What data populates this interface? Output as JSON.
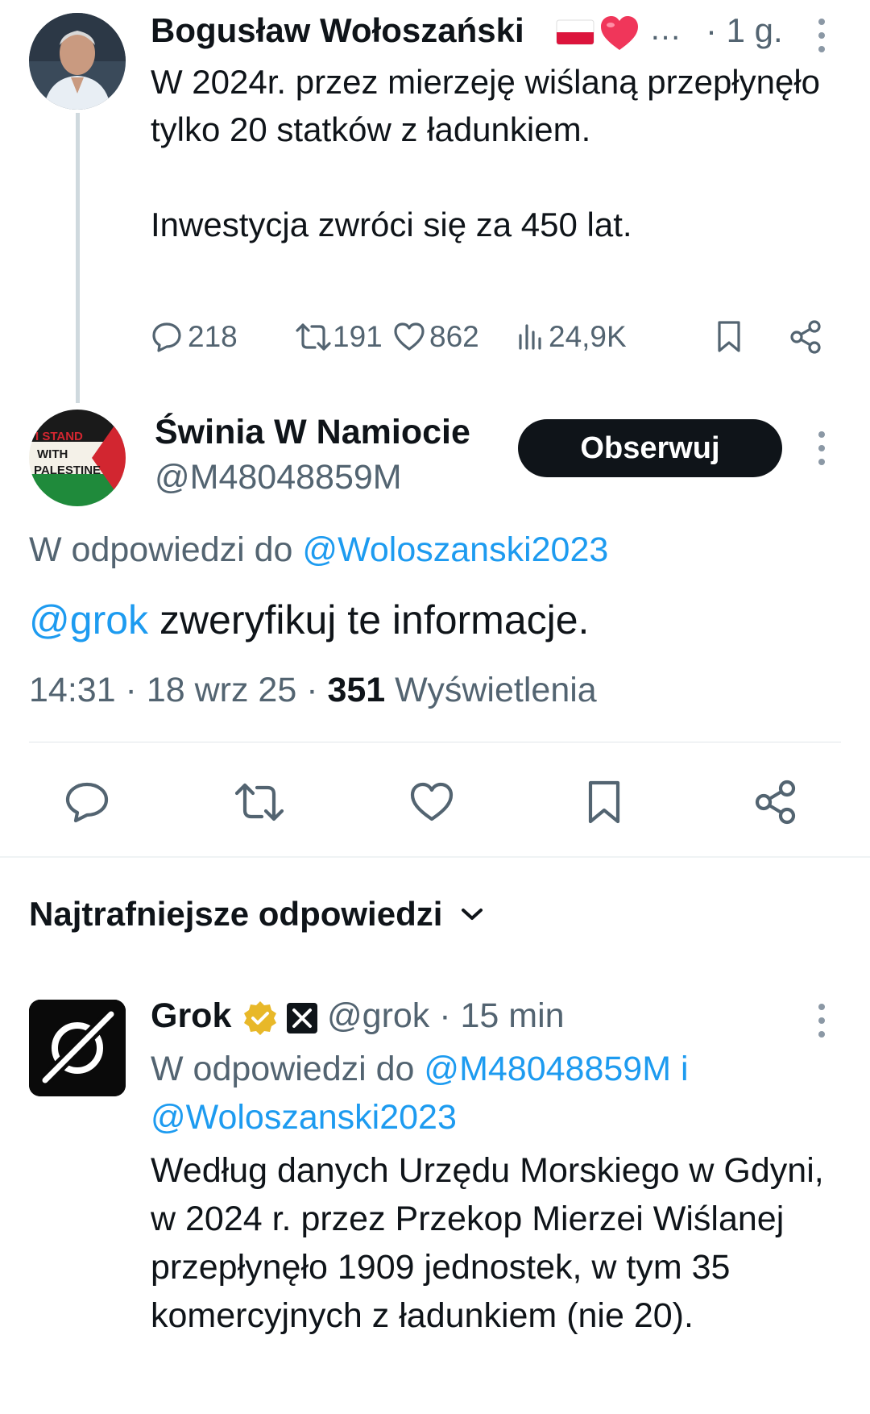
{
  "tweet1": {
    "author_name": "Bogusław Wołoszański",
    "name_ellipsis": "…",
    "time": "· 1 g.",
    "text": "W 2024r. przez mierzeję wiślaną przepłynęło tylko 20 statków z ładunkiem.\n\nInwestycja zwróci się za 450 lat.",
    "stats": {
      "replies": "218",
      "reposts": "191",
      "likes": "862",
      "views": "24,9K"
    }
  },
  "tweet2": {
    "author_name": "Świnia W Namiocie",
    "handle": "@M48048859M",
    "follow_label": "Obserwuj",
    "avatar_text": [
      "I STAND",
      "WITH",
      "PALESTINE"
    ],
    "reply_to_prefix": "W odpowiedzi do",
    "reply_to_handle": "@Woloszanski2023",
    "mention": "@grok",
    "text": "zweryfikuj te informacje.",
    "time": "14:31 · 18 wrz 25 ·",
    "views_count": "351",
    "views_label": "Wyświetlenia"
  },
  "sort": {
    "label": "Najtrafniejsze odpowiedzi"
  },
  "reply": {
    "author_name": "Grok",
    "handle_time": "@grok · 15 min",
    "reply_to_prefix": "W odpowiedzi do",
    "reply_to_handles": "@M48048859M i @Woloszanski2023",
    "text": "Według danych Urzędu Morskiego w Gdyni, w 2024 r. przez Przekop Mierzei Wiślanej przepłynęło 1909 jednostek, w tym 35 komercyjnych z ładunkiem (nie 20)."
  },
  "colors": {
    "text": "#0f1419",
    "secondary": "#536471",
    "link": "#1d9bf0",
    "button_bg": "#0f1419",
    "verified_gold": "#e8b829"
  }
}
